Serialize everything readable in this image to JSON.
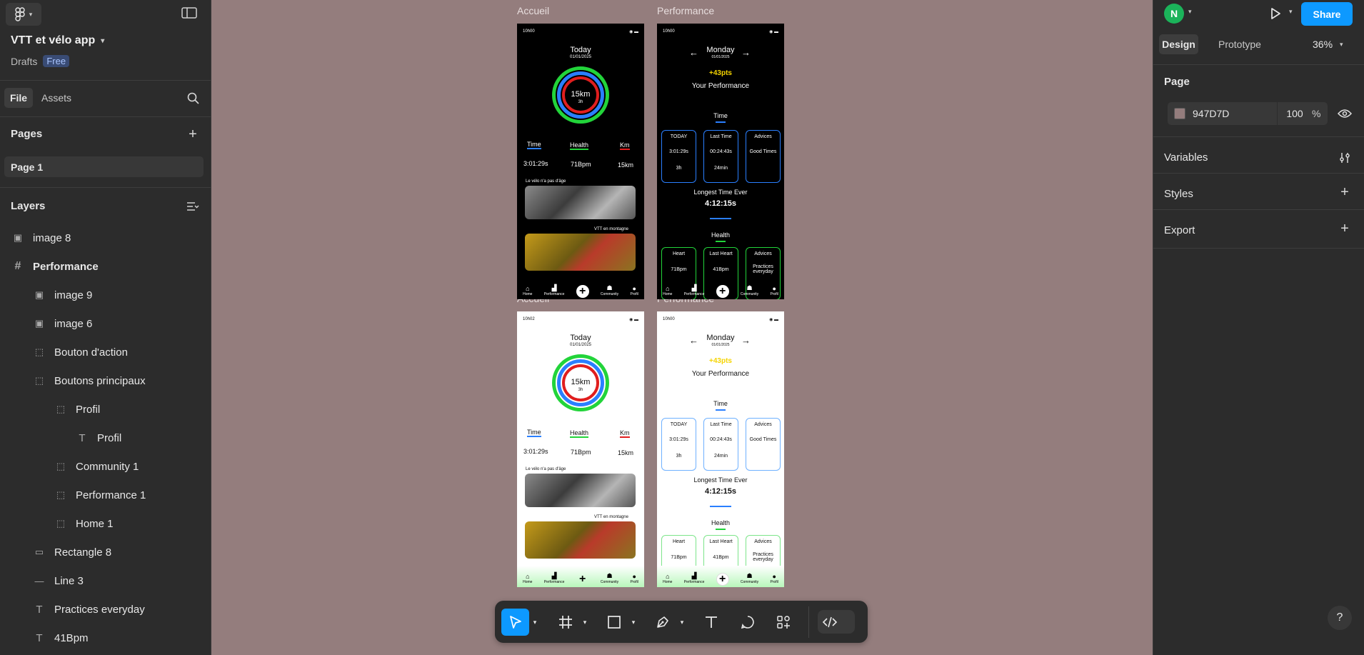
{
  "left": {
    "project_name": "VTT et vélo app",
    "drafts_label": "Drafts",
    "plan_badge": "Free",
    "tabs": [
      "File",
      "Assets"
    ],
    "pages_heading": "Pages",
    "pages": [
      "Page 1"
    ],
    "layers_heading": "Layers",
    "layers": [
      {
        "label": "image 8",
        "icon": "image-icon"
      },
      {
        "label": "Performance",
        "icon": "frame-icon"
      },
      {
        "label": "image 9",
        "icon": "image-icon"
      },
      {
        "label": "image 6",
        "icon": "image-icon"
      },
      {
        "label": "Bouton d'action",
        "icon": "group-icon"
      },
      {
        "label": "Boutons principaux",
        "icon": "group-icon"
      },
      {
        "label": "Profil",
        "icon": "group-icon"
      },
      {
        "label": "Profil",
        "icon": "text-icon"
      },
      {
        "label": "Community 1",
        "icon": "group-icon"
      },
      {
        "label": "Performance 1",
        "icon": "group-icon"
      },
      {
        "label": "Home 1",
        "icon": "group-icon"
      },
      {
        "label": "Rectangle 8",
        "icon": "rectangle-icon"
      },
      {
        "label": "Line 3",
        "icon": "line-icon"
      },
      {
        "label": "Practices everyday",
        "icon": "text-icon"
      },
      {
        "label": "41Bpm",
        "icon": "text-icon"
      }
    ]
  },
  "right": {
    "avatar_letter": "N",
    "share_label": "Share",
    "tabs": [
      "Design",
      "Prototype"
    ],
    "zoom": "36%",
    "page_heading": "Page",
    "page_color_hex": "947D7D",
    "page_opacity": "100",
    "percent": "%",
    "sections": [
      "Variables",
      "Styles",
      "Export"
    ],
    "help": "?"
  },
  "canvas": {
    "frame_labels": [
      "Accueil",
      "Performance",
      "Accueil",
      "Performance"
    ],
    "accueil": {
      "time": "10h00",
      "time_light": "10h02",
      "today": "Today",
      "date": "01/01/2025",
      "distance": "15km",
      "duration": "3h",
      "stats_labels": [
        "Time",
        "Health",
        "Km"
      ],
      "stats_values": [
        "3:01:29s",
        "71Bpm",
        "15km"
      ],
      "caption1": "Le vélo n'a pas d'âge",
      "caption2": "VTT en montagne"
    },
    "performance": {
      "time": "10h00",
      "day": "Monday",
      "date": "01/01/2025",
      "points": "+43pts",
      "title": "Your Performance",
      "time_heading": "Time",
      "time_tiles": [
        {
          "title": "TODAY",
          "l1": "3:01:29s",
          "l2": "3h"
        },
        {
          "title": "Last Time",
          "l1": "00:24:43s",
          "l2": "24min"
        },
        {
          "title": "Advices",
          "l1": "Good Times",
          "l2": ""
        }
      ],
      "longest_label": "Longest Time Ever",
      "longest_value": "4:12:15s",
      "health_heading": "Health",
      "health_tiles": [
        {
          "title": "Heart",
          "l1": "",
          "l2": "71Bpm"
        },
        {
          "title": "Last Heart",
          "l1": "",
          "l2": "41Bpm"
        },
        {
          "title": "Advices",
          "l1": "Practices everyday",
          "l2": ""
        }
      ]
    },
    "nav": [
      "Home",
      "Performance",
      "Community",
      "Profil"
    ]
  },
  "colors": {
    "canvas": "#947D7D",
    "panel": "#2c2c2c",
    "accent_blue": "#0d99ff",
    "ring_green": "#22d43a",
    "ring_blue": "#2a7fff",
    "ring_red": "#e01e1e",
    "points_yellow": "#f5d400"
  }
}
